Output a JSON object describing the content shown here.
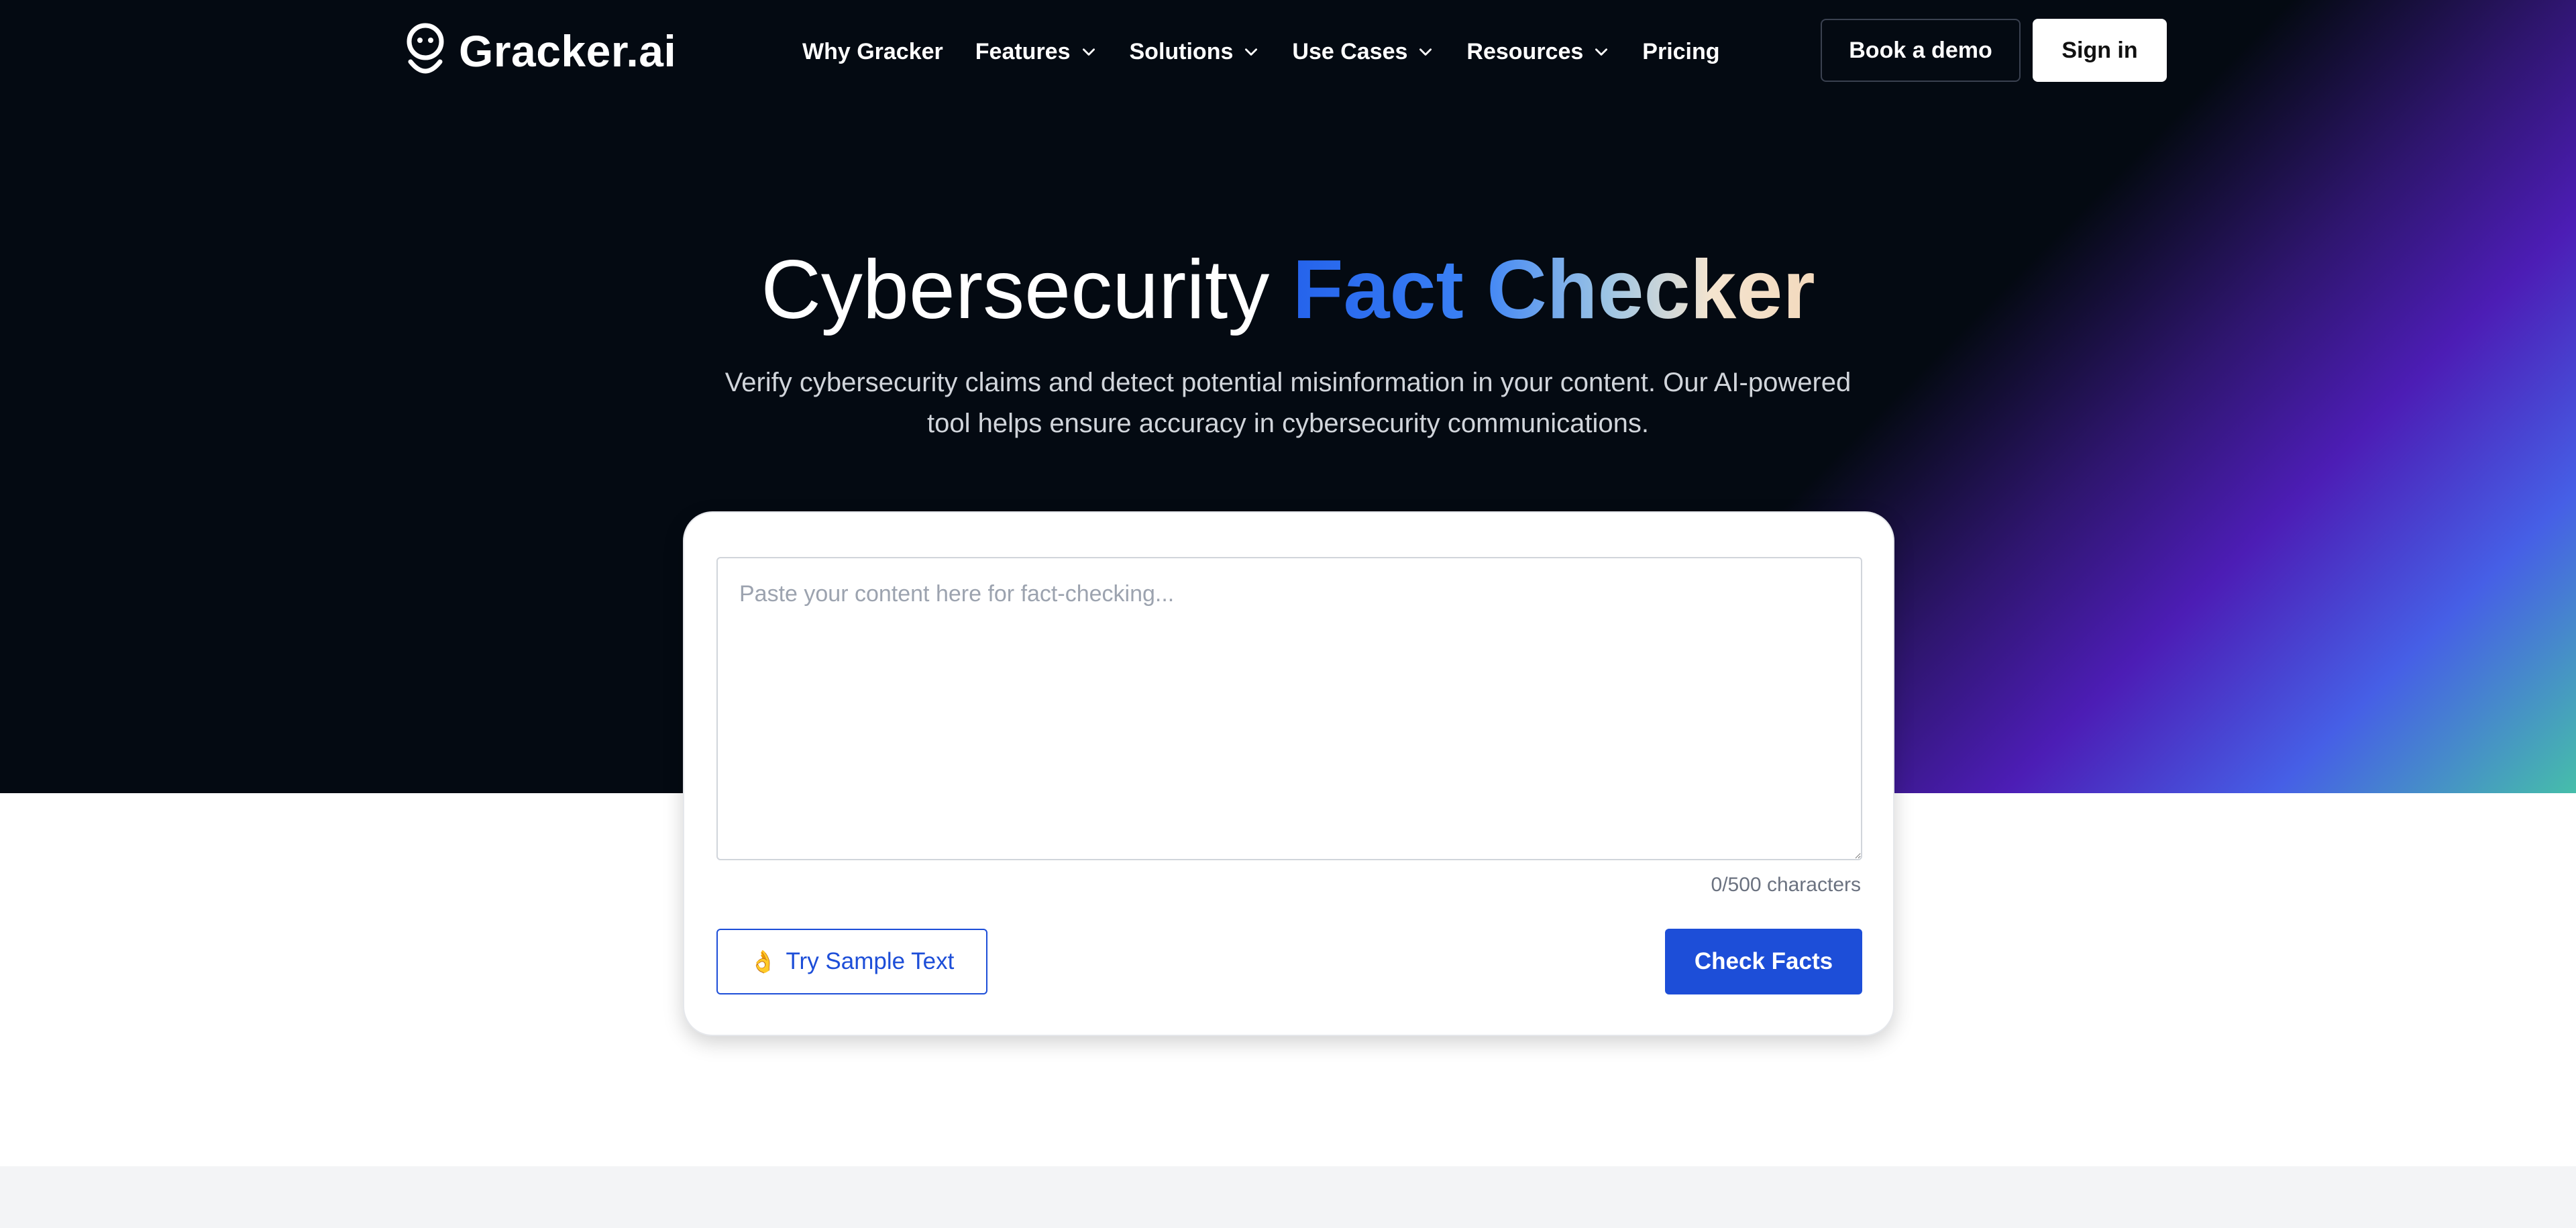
{
  "brand": {
    "name": "Gracker.ai"
  },
  "nav": {
    "items": [
      {
        "label": "Why Gracker",
        "has_dropdown": false
      },
      {
        "label": "Features",
        "has_dropdown": true
      },
      {
        "label": "Solutions",
        "has_dropdown": true
      },
      {
        "label": "Use Cases",
        "has_dropdown": true
      },
      {
        "label": "Resources",
        "has_dropdown": true
      },
      {
        "label": "Pricing",
        "has_dropdown": false
      }
    ],
    "book_demo_label": "Book a demo",
    "sign_in_label": "Sign in"
  },
  "hero": {
    "title_plain": "Cybersecurity ",
    "title_accent": "Fact Checker",
    "subtitle": "Verify cybersecurity claims and detect potential misinformation in your content. Our AI-powered tool helps ensure accuracy in cybersecurity communications."
  },
  "checker": {
    "textarea_value": "",
    "textarea_placeholder": "Paste your content here for fact-checking...",
    "char_count": "0/500 characters",
    "sample_button_emoji": "👌",
    "sample_button_label": "Try Sample Text",
    "check_button_label": "Check Facts"
  },
  "colors": {
    "hero_bg": "#040a12",
    "primary": "#1d4ed8",
    "accent_gradient_start": "#2563eb",
    "accent_gradient_end": "#f3d9bd"
  }
}
